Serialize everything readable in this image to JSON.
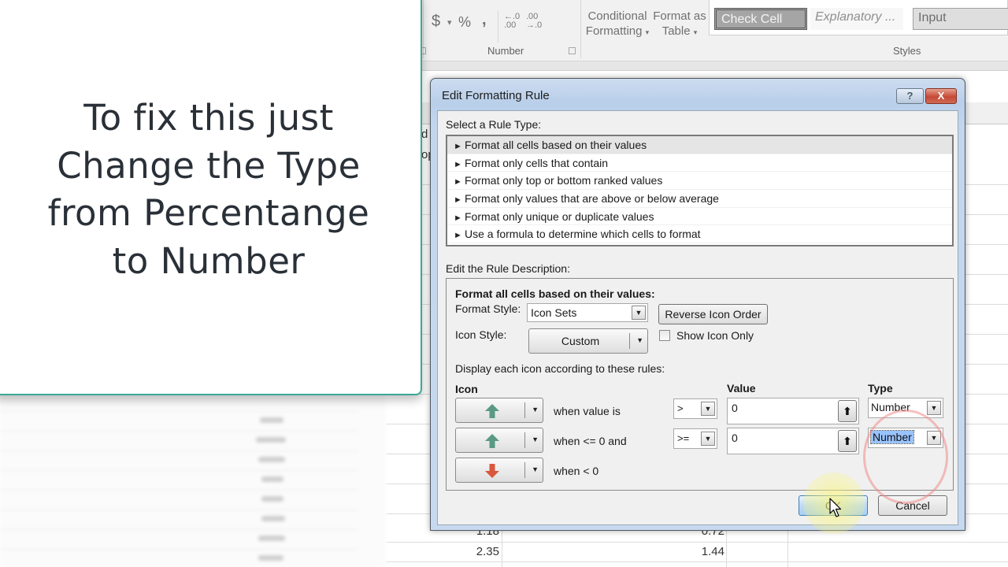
{
  "ribbon": {
    "number_group": {
      "label": "Number",
      "currency_symbol": "$",
      "percent_symbol": "%",
      "comma_symbol": ",",
      "increase_decimal": "←.0 .00",
      "decrease_decimal": ".00 →.0"
    },
    "conditional_formatting": {
      "line1": "Conditional",
      "line2": "Formatting"
    },
    "format_as_table": {
      "line1": "Format as",
      "line2": "Table"
    },
    "styles": {
      "label": "Styles",
      "gallery": [
        "Check Cell",
        "Explanatory ...",
        "Input"
      ]
    }
  },
  "sheet": {
    "partial_cells": [
      "d",
      "op"
    ],
    "rows": [
      {
        "col_a": "1.18",
        "col_b": "0.72"
      },
      {
        "col_a": "2.35",
        "col_b": "1.44"
      }
    ]
  },
  "overlay": {
    "lines": [
      "To fix this just",
      "Change the Type",
      "from Percentange",
      "to Number"
    ]
  },
  "dialog": {
    "title": "Edit Formatting Rule",
    "help_label": "?",
    "close_label": "X",
    "rule_type_label": "Select a Rule Type:",
    "rule_types": [
      {
        "label": "Format all cells based on their values",
        "selected": true
      },
      {
        "label": "Format only cells that contain",
        "selected": false
      },
      {
        "label": "Format only top or bottom ranked values",
        "selected": false
      },
      {
        "label": "Format only values that are above or below average",
        "selected": false
      },
      {
        "label": "Format only unique or duplicate values",
        "selected": false
      },
      {
        "label": "Use a formula to determine which cells to format",
        "selected": false
      }
    ],
    "rule_description_label": "Edit the Rule Description:",
    "description_heading": "Format all cells based on their values:",
    "format_style_label": "Format Style:",
    "format_style_value": "Icon Sets",
    "reverse_icon_order_label": "Reverse Icon Order",
    "icon_style_label": "Icon Style:",
    "icon_style_value": "Custom",
    "show_icon_only_label": "Show Icon Only",
    "show_icon_only_checked": false,
    "display_rules_label": "Display each icon according to these rules:",
    "columns": {
      "icon": "Icon",
      "value": "Value",
      "type": "Type"
    },
    "icon_rules": [
      {
        "icon": "green-up-arrow",
        "condition": "when value is",
        "operator": ">",
        "value": "0",
        "type": "Number",
        "type_highlighted": false
      },
      {
        "icon": "green-up-arrow",
        "condition": "when <= 0 and",
        "operator": ">=",
        "value": "0",
        "type": "Number",
        "type_highlighted": true
      },
      {
        "icon": "red-down-arrow",
        "condition": "when < 0"
      }
    ],
    "ok_label": "OK",
    "cancel_label": "Cancel"
  },
  "colors": {
    "accent_border": "#3ba895",
    "up_arrow": "#5a9a84",
    "down_arrow": "#d9573c",
    "selection": "#99c3ff"
  }
}
